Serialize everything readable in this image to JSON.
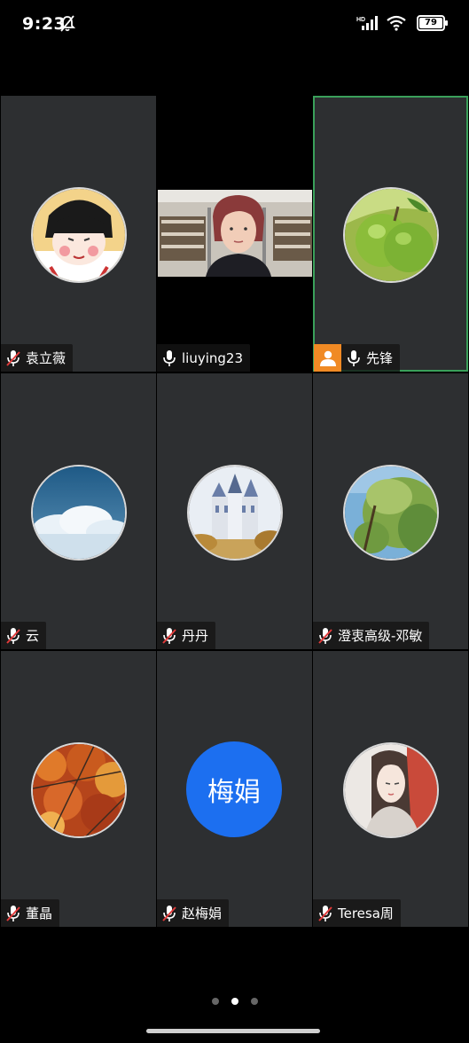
{
  "status": {
    "time": "9:23",
    "battery": "79",
    "network": "HD",
    "icons": [
      "dnd-icon",
      "hd-icon",
      "signal-icon",
      "wifi-icon",
      "battery-icon"
    ]
  },
  "participants": [
    {
      "name": "袁立薇",
      "mic": "muted",
      "avatar": "cartoon-girl"
    },
    {
      "name": "liuying23",
      "mic": "on",
      "avatar": "video"
    },
    {
      "name": "先锋",
      "mic": "on",
      "avatar": "green-fruit",
      "host": true,
      "speaking": true
    },
    {
      "name": "云",
      "mic": "muted",
      "avatar": "clouds"
    },
    {
      "name": "丹丹",
      "mic": "muted",
      "avatar": "castle"
    },
    {
      "name": "澄衷高级-邓敏",
      "mic": "muted",
      "avatar": "green-tree"
    },
    {
      "name": "董晶",
      "mic": "muted",
      "avatar": "autumn-leaves"
    },
    {
      "name": "赵梅娟",
      "mic": "muted",
      "avatar_text": "梅娟"
    },
    {
      "name": "Teresa周",
      "mic": "muted",
      "avatar": "painted-woman"
    }
  ],
  "pager": {
    "pages": 3,
    "current": 2
  },
  "colors": {
    "tile": "#2d2f31",
    "active_border": "#3aa05a",
    "host_badge": "#f08a24",
    "text_avatar": "#1c6ff0",
    "muted_red": "#e23b3b"
  }
}
